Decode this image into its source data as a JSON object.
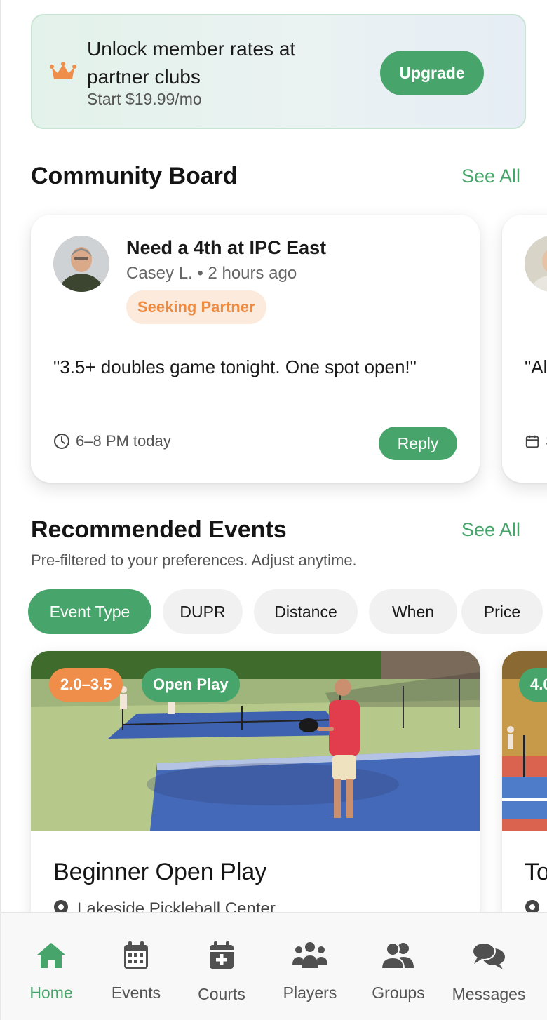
{
  "colors": {
    "accent": "#47a56b",
    "orange": "#ef8e4b",
    "tag_bg": "#fcebdc"
  },
  "banner": {
    "icon": "crown-icon",
    "title": "Unlock member rates at partner clubs",
    "subtitle": "Start $19.99/mo",
    "button": "Upgrade"
  },
  "community": {
    "title": "Community Board",
    "see_all": "See All",
    "posts": [
      {
        "title": "Need a 4th at IPC East",
        "meta": "Casey L. • 2 hours ago",
        "tag": "Seeking Partner",
        "quote": "\"3.5+ doubles game tonight. One spot open!\"",
        "time": "6–8 PM today",
        "time_icon": "clock-icon",
        "reply": "Reply"
      },
      {
        "quote_partial": "\"Al",
        "time_icon": "calendar-icon",
        "time_partial": "S"
      }
    ]
  },
  "events": {
    "title": "Recommended Events",
    "see_all": "See All",
    "subtitle": "Pre-filtered to your preferences. Adjust anytime.",
    "filters": [
      "Event Type",
      "DUPR",
      "Distance",
      "When",
      "Price"
    ],
    "active_filter": "Event Type",
    "cards": [
      {
        "level": "2.0–3.5",
        "type": "Open Play",
        "title": "Beginner Open Play",
        "location": "Lakeside Pickleball Center"
      },
      {
        "level_partial": "4.0",
        "title_partial": "To"
      }
    ]
  },
  "nav": {
    "items": [
      {
        "label": "Home",
        "icon": "home-icon",
        "active": true
      },
      {
        "label": "Events",
        "icon": "calendar-icon",
        "active": false
      },
      {
        "label": "Courts",
        "icon": "calendar-plus-icon",
        "active": false
      },
      {
        "label": "Players",
        "icon": "players-icon",
        "active": false
      },
      {
        "label": "Groups",
        "icon": "groups-icon",
        "active": false
      },
      {
        "label": "Messages",
        "icon": "messages-icon",
        "active": false
      }
    ]
  }
}
